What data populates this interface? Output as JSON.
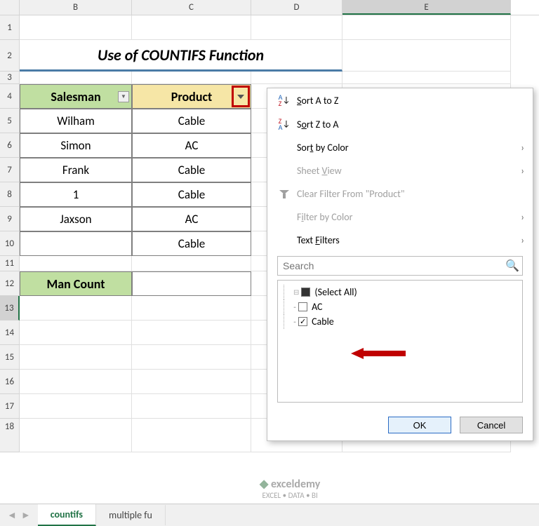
{
  "cols": [
    "B",
    "C",
    "D",
    "E"
  ],
  "rows": [
    "1",
    "2",
    "3",
    "4",
    "5",
    "6",
    "7",
    "8",
    "9",
    "10",
    "11",
    "12",
    "13",
    "14",
    "15",
    "16",
    "17",
    "18"
  ],
  "title": "Use of COUNTIFS Function",
  "headers": {
    "salesman": "Salesman",
    "product": "Product"
  },
  "data_rows": [
    {
      "salesman": "Wilham",
      "product": "Cable"
    },
    {
      "salesman": "Simon",
      "product": "AC"
    },
    {
      "salesman": "Frank",
      "product": "Cable"
    },
    {
      "salesman": "1",
      "product": "Cable"
    },
    {
      "salesman": "Jaxson",
      "product": "AC"
    },
    {
      "salesman": "",
      "product": "Cable"
    }
  ],
  "man_count_label": "Man Count",
  "filter_menu": {
    "sort_az": "Sort A to Z",
    "sort_za": "Sort Z to A",
    "sort_color": "Sort by Color",
    "sheet_view": "Sheet View",
    "clear": "Clear Filter From \"Product\"",
    "filter_color": "Filter by Color",
    "text_filters": "Text Filters",
    "search_ph": "Search",
    "items": {
      "select_all": "(Select All)",
      "ac": "AC",
      "cable": "Cable"
    },
    "ok": "OK",
    "cancel": "Cancel"
  },
  "tabs": {
    "active": "countifs",
    "other": "multiple fu"
  },
  "watermark": {
    "name": "exceldemy",
    "tag": "EXCEL • DATA • BI"
  }
}
